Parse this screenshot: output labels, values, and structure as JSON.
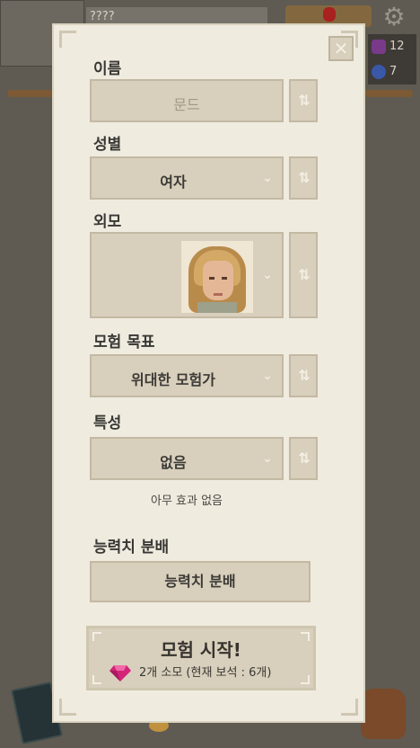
{
  "background": {
    "name_bar_text": "????",
    "gear_glyph": "⚙",
    "stats": [
      {
        "icon": "purple-gem-icon",
        "color": "#7a3a8a",
        "value": "12"
      },
      {
        "icon": "blue-ring-icon",
        "color": "#3a58a8",
        "value": "7"
      }
    ]
  },
  "dialog": {
    "close_glyph": "✕",
    "name": {
      "label": "이름",
      "value": "문드"
    },
    "gender": {
      "label": "성별",
      "value": "여자"
    },
    "appearance": {
      "label": "외모"
    },
    "goal": {
      "label": "모험 목표",
      "value": "위대한 모험가"
    },
    "trait": {
      "label": "특성",
      "value": "없음",
      "description": "아무 효과 없음"
    },
    "stats": {
      "label": "능력치 분배",
      "button": "능력치 분배"
    },
    "start": {
      "title": "모험 시작!",
      "cost": "2개 소모 (현재 보석 : 6개)"
    },
    "chevron_glyph": "⌄",
    "reroll_glyph": "⇅"
  },
  "colors": {
    "panel": "#efebdf",
    "field": "#d8cfbc",
    "gem": "#d4247a"
  }
}
